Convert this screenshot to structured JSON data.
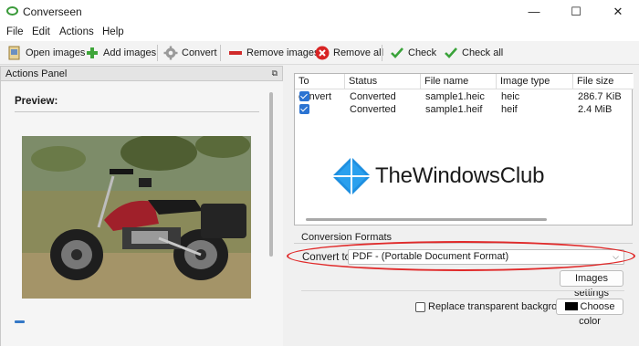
{
  "window": {
    "title": "Converseen",
    "minimize_glyph": "—",
    "maximize_glyph": "☐",
    "close_glyph": "✕"
  },
  "menu": [
    "File",
    "Edit",
    "Actions",
    "Help"
  ],
  "toolbar": [
    {
      "label": "Open images",
      "icon": "open-images-icon"
    },
    {
      "label": "Add images",
      "icon": "add-images-icon"
    },
    {
      "label": "Convert",
      "icon": "convert-gear-icon"
    },
    {
      "label": "Remove images",
      "icon": "remove-images-icon"
    },
    {
      "label": "Remove all",
      "icon": "remove-all-icon"
    },
    {
      "label": "Check",
      "icon": "check-icon"
    },
    {
      "label": "Check all",
      "icon": "check-all-icon"
    }
  ],
  "actions_panel": {
    "title": "Actions Panel",
    "float_glyph": "⧉",
    "preview_label": "Preview:"
  },
  "table": {
    "columns": [
      "To convert",
      "Status",
      "File name",
      "Image type",
      "File size"
    ],
    "rows": [
      {
        "checked": true,
        "status": "Converted",
        "file_name": "sample1.heic",
        "image_type": "heic",
        "file_size": "286.7 KiB"
      },
      {
        "checked": true,
        "status": "Converted",
        "file_name": "sample1.heif",
        "image_type": "heif",
        "file_size": "2.4 MiB"
      }
    ]
  },
  "watermark": {
    "text": "TheWindowsClub"
  },
  "conversion": {
    "section_label": "Conversion Formats",
    "convert_to_label": "Convert to:",
    "selected_format": "PDF - (Portable Document Format)",
    "images_settings_label": "Images settings",
    "replace_transparent_label": "Replace transparent background",
    "replace_transparent_checked": false,
    "choose_color_label": "Choose color",
    "color_value": "#000000"
  },
  "colors": {
    "accent": "#2b73d2",
    "highlight": "#e02a2a",
    "watermark_blue": "#1e8fe0"
  }
}
